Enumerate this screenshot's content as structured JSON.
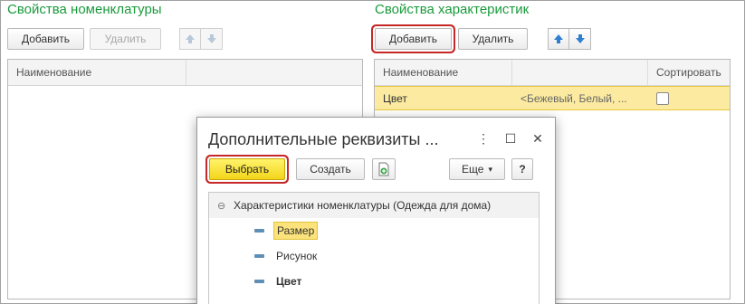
{
  "left_panel": {
    "title": "Свойства номенклатуры",
    "add_label": "Добавить",
    "delete_label": "Удалить",
    "column_name": "Наименование"
  },
  "right_panel": {
    "title": "Свойства характеристик",
    "add_label": "Добавить",
    "delete_label": "Удалить",
    "column_name": "Наименование",
    "column_sort": "Сортировать",
    "rows": [
      {
        "name": "Цвет",
        "values": "<Бежевый, Белый, ...",
        "sort_checked": false
      }
    ]
  },
  "dialog": {
    "title": "Дополнительные реквизиты ...",
    "more_dots": "⋮",
    "maximize": "☐",
    "close": "✕",
    "select_label": "Выбрать",
    "create_label": "Создать",
    "more_label": "Еще",
    "more_arrow": "▾",
    "help_label": "?",
    "group_toggle": "⊖",
    "group_label": "Характеристики номенклатуры (Одежда для дома)",
    "items": [
      {
        "label": "Размер",
        "selected": true,
        "bold": false
      },
      {
        "label": "Рисунок",
        "selected": false,
        "bold": false
      },
      {
        "label": "Цвет",
        "selected": false,
        "bold": true
      }
    ]
  },
  "colors": {
    "title_green": "#1a9a3c",
    "highlight_red": "#c62828",
    "primary_yellow": "#f3d51a",
    "selection_yellow": "#fbeaa0",
    "arrow_blue": "#2f7fd0"
  },
  "icons": {
    "up": "arrow-up-icon",
    "down": "arrow-down-icon",
    "copy": "copy-document-icon",
    "item": "attribute-dash-icon"
  }
}
